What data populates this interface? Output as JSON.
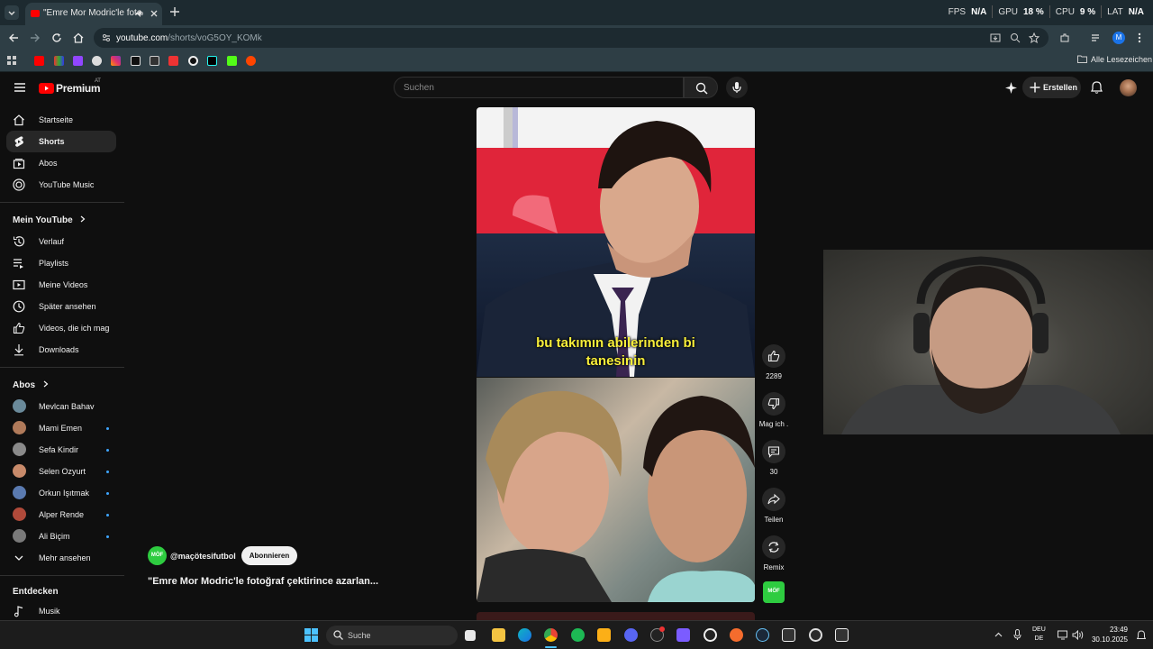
{
  "browser": {
    "tab_title": "\"Emre Mor Modric'le fotoğ",
    "url_host": "youtube.com",
    "url_path": "/shorts/voG5OY_KOMk",
    "bookmarks_folder": "Alle Lesezeichen",
    "profile_initial": "M",
    "overlay": {
      "fps_label": "FPS",
      "fps_value": "N/A",
      "gpu_label": "GPU",
      "gpu_value": "18 %",
      "cpu_label": "CPU",
      "cpu_value": "9 %",
      "lat_label": "LAT",
      "lat_value": "N/A"
    }
  },
  "youtube": {
    "logo_text": "Premium",
    "region": "AT",
    "search_placeholder": "Suchen",
    "create_label": "Erstellen"
  },
  "sidebar": {
    "main_items": [
      {
        "label": "Startseite",
        "icon": "home-icon"
      },
      {
        "label": "Shorts",
        "icon": "shorts-icon"
      },
      {
        "label": "Abos",
        "icon": "subscriptions-icon"
      },
      {
        "label": "YouTube Music",
        "icon": "music-icon"
      }
    ],
    "my_youtube_heading": "Mein YouTube",
    "my_youtube_items": [
      {
        "label": "Verlauf",
        "icon": "history-icon"
      },
      {
        "label": "Playlists",
        "icon": "playlists-icon"
      },
      {
        "label": "Meine Videos",
        "icon": "my-videos-icon"
      },
      {
        "label": "Später ansehen",
        "icon": "watch-later-icon"
      },
      {
        "label": "Videos, die ich mag",
        "icon": "liked-icon"
      },
      {
        "label": "Downloads",
        "icon": "download-icon"
      }
    ],
    "subs_heading": "Abos",
    "subscriptions": [
      {
        "label": "Mevlcan Bahav",
        "color": "#6a8a9a",
        "new": false
      },
      {
        "label": "Mami Emen",
        "color": "#b07a5a",
        "new": true
      },
      {
        "label": "Sefa Kindir",
        "color": "#8a8a8a",
        "new": true
      },
      {
        "label": "Selen Ozyurt",
        "color": "#c88a6a",
        "new": true
      },
      {
        "label": "Orkun Işıtmak",
        "color": "#5a7ab0",
        "new": true
      },
      {
        "label": "Alper Rende",
        "color": "#b04a3a",
        "new": true
      },
      {
        "label": "Ali Biçim",
        "color": "#7a7a7a",
        "new": true
      }
    ],
    "show_more": "Mehr ansehen",
    "explore_heading": "Entdecken",
    "explore_items": [
      {
        "label": "Musik",
        "icon": "music-note-icon"
      }
    ]
  },
  "short": {
    "caption_line1": "bu takımın abilerinden bi",
    "caption_line2": "tanesinin",
    "channel_handle": "@maçötesifutbol",
    "channel_avatar_text": "MÖF",
    "subscribe_label": "Abonnieren",
    "title": "\"Emre Mor Modric'le fotoğraf çektirince azarlan...",
    "likes": "2289",
    "dislike_label": "Mag ich .",
    "comments": "30",
    "share_label": "Teilen",
    "remix_label": "Remix"
  },
  "taskbar": {
    "search_placeholder": "Suche",
    "lang_line1": "DEU",
    "lang_line2": "DE",
    "time": "23:49",
    "date": "30.10.2025"
  }
}
